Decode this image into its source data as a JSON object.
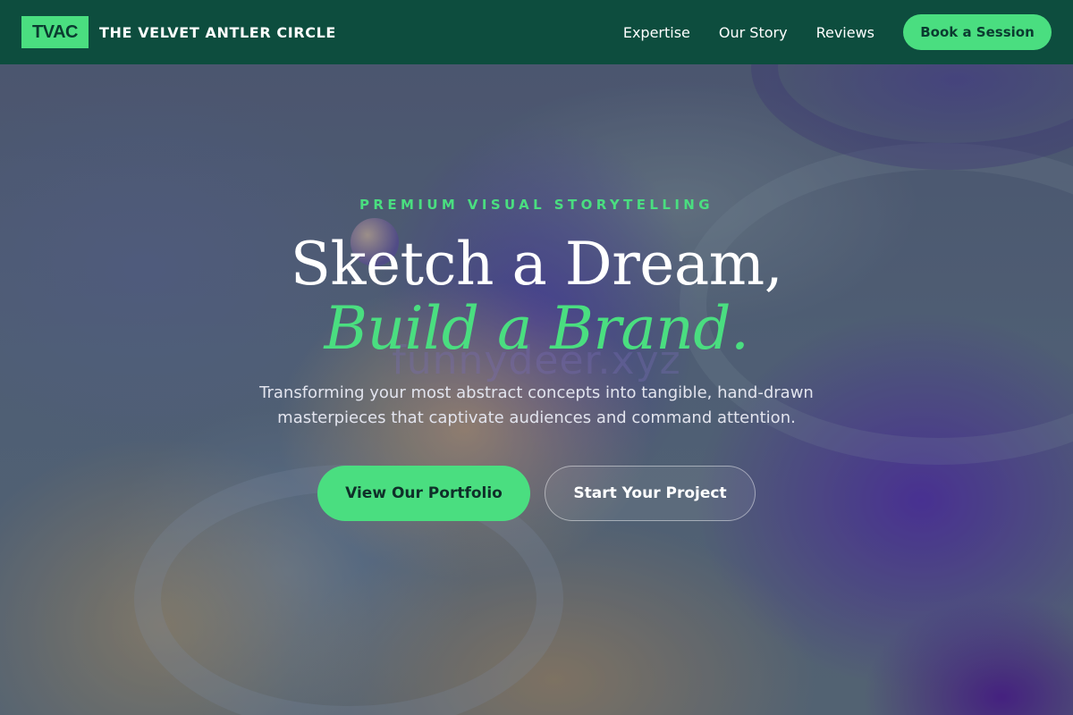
{
  "nav": {
    "logo_text": "TVAC",
    "brand_name": "THE VELVET ANTLER CIRCLE",
    "links": [
      {
        "label": "Expertise"
      },
      {
        "label": "Our Story"
      },
      {
        "label": "Reviews"
      }
    ],
    "cta_label": "Book a Session"
  },
  "hero": {
    "eyebrow": "PREMIUM VISUAL STORYTELLING",
    "headline_line1": "Sketch a Dream,",
    "headline_line2": "Build a Brand.",
    "subtitle": "Transforming your most abstract concepts into tangible, hand-drawn masterpieces that captivate audiences and command attention.",
    "primary_button": "View Our Portfolio",
    "secondary_button": "Start Your Project",
    "watermark": "funnydeer.xyz"
  },
  "colors": {
    "nav_bg": "#0d4d3e",
    "accent": "#4ade80",
    "heading": "#ffffff",
    "subtitle": "#e2e4ee"
  }
}
